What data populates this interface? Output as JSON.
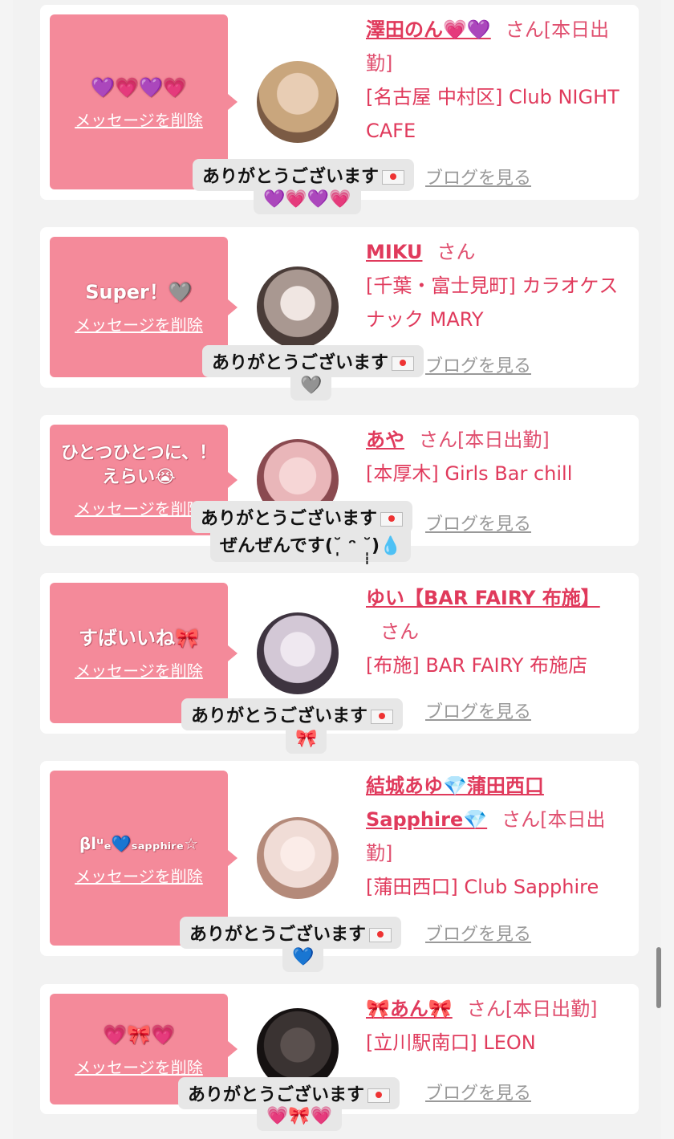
{
  "common": {
    "delete_label": "メッセージを削除",
    "blog_label": "ブログを見る",
    "toast_label": "ありがとうございます"
  },
  "cards": [
    {
      "stamp": "💜💗💜💗",
      "name": "澤田のん💗💜",
      "honorific": "さん[本日出勤]",
      "shop": "[名古屋 中村区] Club NIGHT CAFE",
      "toast_tail": "💜💗💜💗",
      "avatar_colors": [
        "#c9a67d",
        "#7b5b44"
      ]
    },
    {
      "stamp": "Super！🩶",
      "name": "MIKU",
      "honorific": "さん",
      "shop": "[千葉・富士見町] カラオケスナック MARY",
      "toast_tail": "🩶",
      "avatar_colors": [
        "#d8d0cc",
        "#4a3c38"
      ]
    },
    {
      "stamp": "ひとつひとつに、！えらい😭",
      "name": "あや",
      "honorific": "さん[本日出勤]",
      "shop": "[本厚木] Girls Bar chill",
      "toast_tail": "ぜんぜんです(˘̩̩̩ ᵔ ˘̩̩̩)💧",
      "avatar_colors": [
        "#e9b6b9",
        "#8a4a50"
      ]
    },
    {
      "stamp": "すばいいね🎀",
      "name": "ゆい【BAR FAIRY 布施】",
      "honorific": "さん",
      "shop": "[布施] BAR FAIRY 布施店",
      "toast_tail": "🎀",
      "avatar_colors": [
        "#d3c8d6",
        "#3e3440"
      ]
    },
    {
      "stamp": "βlᵘₑ💙ₛₐₚₚₕᵢᵣₑ☆",
      "name": "結城あゆ💎蒲田西口Sapphire💎",
      "honorific": "さん[本日出勤]",
      "shop": "[蒲田西口] Club Sapphire",
      "toast_tail": "💙",
      "avatar_colors": [
        "#f0dcd6",
        "#b48a7a"
      ]
    },
    {
      "stamp": "💗🎀💗",
      "name": "🎀あん🎀",
      "honorific": "さん[本日出勤]",
      "shop": "[立川駅南口] LEON",
      "toast_tail": "💗🎀💗",
      "avatar_colors": [
        "#3a3332",
        "#151111"
      ]
    }
  ]
}
